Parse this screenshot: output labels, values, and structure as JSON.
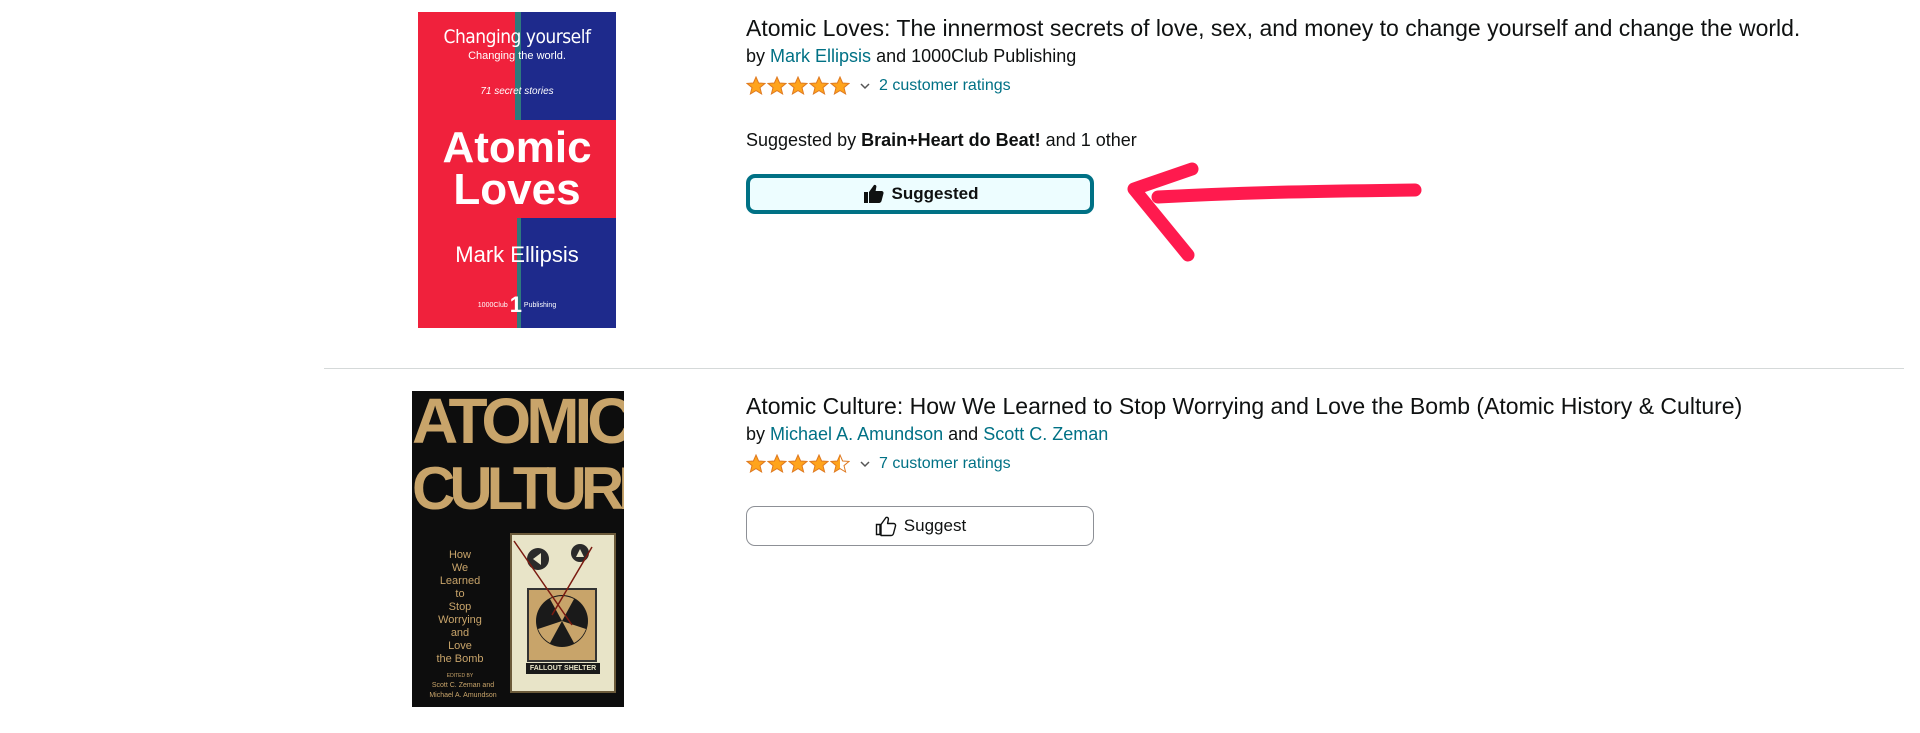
{
  "results": [
    {
      "cover": {
        "top_line": "Changing yourself",
        "sub_line": "Changing the world.",
        "tag_line": "71 secret stories",
        "title_line1": "Atomic",
        "title_line2": "Loves",
        "author": "Mark Ellipsis",
        "publisher_left": "1000Club",
        "publisher_mark": "1",
        "publisher_right": "Publishing",
        "colors": {
          "red": "#f0213c",
          "blue": "#1e2a8c",
          "teal": "#2e7a7c"
        }
      },
      "title": "Atomic Loves: The innermost secrets of love, sex, and money to change yourself and change the world.",
      "by_prefix": "by",
      "authors": [
        "Mark Ellipsis"
      ],
      "author_joiner": "and",
      "publisher_text": "1000Club Publishing",
      "rating_value": 5,
      "rating_count_text": "2 customer ratings",
      "suggested_by": {
        "prefix": "Suggested by",
        "name": "Brain+Heart do Beat!",
        "suffix": "and 1 other"
      },
      "button": {
        "label": "Suggested",
        "state": "active"
      },
      "annotation": {
        "type": "arrow",
        "color": "#ff1a4e"
      }
    },
    {
      "cover": {
        "title_line1": "ATOMIC",
        "title_line2": "CULTURE",
        "subtitle_lines": [
          "How",
          "We",
          "Learned",
          "to",
          "Stop",
          "Worrying",
          "and",
          "Love",
          "the Bomb"
        ],
        "sign_text": "FALLOUT SHELTER",
        "edited_by": "EDITED BY",
        "editors_line1": "Scott C. Zeman and",
        "editors_line2": "Michael A. Amundson",
        "colors": {
          "gold": "#c8a46a",
          "black": "#0d0d0d",
          "panel": "#e8e4c8"
        }
      },
      "title": "Atomic Culture: How We Learned to Stop Worrying and Love the Bomb (Atomic History & Culture)",
      "by_prefix": "by",
      "authors": [
        "Michael A. Amundson",
        "Scott C. Zeman"
      ],
      "author_joiner": "and",
      "rating_value": 4.5,
      "rating_count_text": "7 customer ratings",
      "button": {
        "label": "Suggest",
        "state": "inactive"
      }
    }
  ],
  "theme": {
    "link": "#007185",
    "star": "#ffa41c",
    "star_stroke": "#de7921"
  }
}
